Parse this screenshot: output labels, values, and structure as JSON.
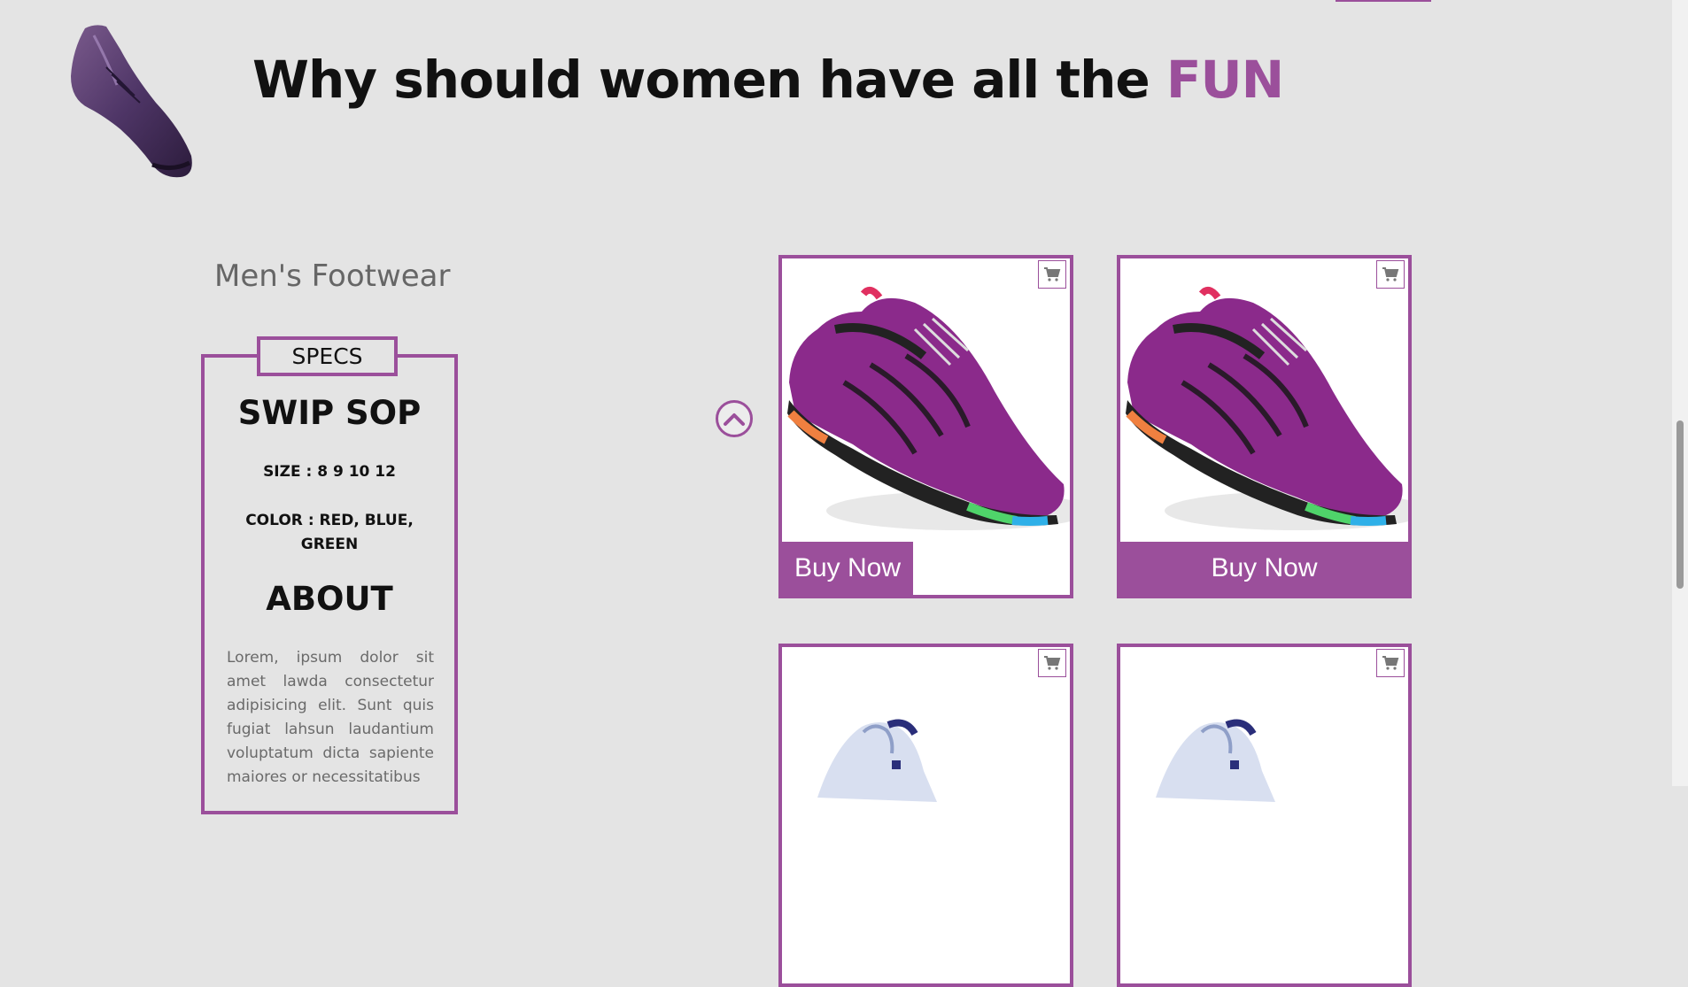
{
  "colors": {
    "accent": "#9b4f9b",
    "background": "#e4e4e4",
    "muted_text": "#6a6a6a"
  },
  "header": {
    "logo_icon": "purple-dress-shoe",
    "headline_prefix": "Why should women have all the",
    "headline_accent": "FUN"
  },
  "section": {
    "title": "Men's Footwear"
  },
  "specs": {
    "tab_label": "SPECS",
    "product_name": "SWIP SOP",
    "size": "SIZE : 8 9 10 12",
    "color": "COLOR : RED, BLUE, GREEN",
    "about_heading": "ABOUT",
    "about_text": "Lorem, ipsum dolor sit amet lawda consectetur adipisicing elit. Sunt quis fugiat lahsun laudantium voluptatum dicta sapiente maiores or necessitatibus"
  },
  "products": [
    {
      "image_icon": "purple-water-shoe",
      "buy_label": "Buy Now",
      "cart_icon": "cart-icon"
    },
    {
      "image_icon": "purple-water-shoe",
      "buy_label": "Buy Now",
      "cart_icon": "cart-icon"
    },
    {
      "image_icon": "white-sneaker",
      "cart_icon": "cart-icon"
    },
    {
      "image_icon": "white-sneaker",
      "cart_icon": "cart-icon"
    }
  ],
  "scroll_up_icon": "chevron-up-icon"
}
